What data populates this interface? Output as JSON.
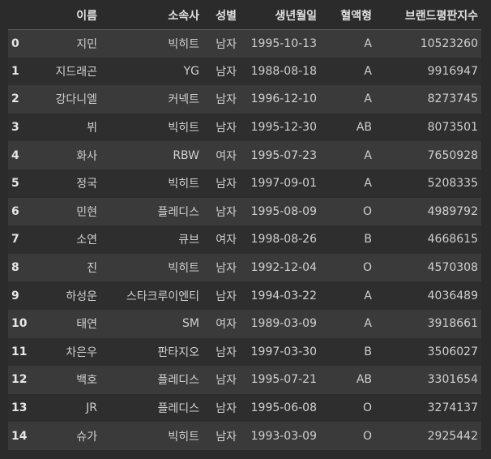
{
  "table": {
    "columns": [
      "",
      "이름",
      "소속사",
      "성별",
      "생년월일",
      "혈액형",
      "브랜드평판지수"
    ],
    "rows": [
      {
        "index": "0",
        "name": "지민",
        "agency": "빅히트",
        "gender": "남자",
        "birth": "1995-10-13",
        "blood": "A",
        "brand": "10523260"
      },
      {
        "index": "1",
        "name": "지드래곤",
        "agency": "YG",
        "gender": "남자",
        "birth": "1988-08-18",
        "blood": "A",
        "brand": "9916947"
      },
      {
        "index": "2",
        "name": "강다니엘",
        "agency": "커넥트",
        "gender": "남자",
        "birth": "1996-12-10",
        "blood": "A",
        "brand": "8273745"
      },
      {
        "index": "3",
        "name": "뷔",
        "agency": "빅히트",
        "gender": "남자",
        "birth": "1995-12-30",
        "blood": "AB",
        "brand": "8073501"
      },
      {
        "index": "4",
        "name": "화사",
        "agency": "RBW",
        "gender": "여자",
        "birth": "1995-07-23",
        "blood": "A",
        "brand": "7650928"
      },
      {
        "index": "5",
        "name": "정국",
        "agency": "빅히트",
        "gender": "남자",
        "birth": "1997-09-01",
        "blood": "A",
        "brand": "5208335"
      },
      {
        "index": "6",
        "name": "민현",
        "agency": "플레디스",
        "gender": "남자",
        "birth": "1995-08-09",
        "blood": "O",
        "brand": "4989792"
      },
      {
        "index": "7",
        "name": "소연",
        "agency": "큐브",
        "gender": "여자",
        "birth": "1998-08-26",
        "blood": "B",
        "brand": "4668615"
      },
      {
        "index": "8",
        "name": "진",
        "agency": "빅히트",
        "gender": "남자",
        "birth": "1992-12-04",
        "blood": "O",
        "brand": "4570308"
      },
      {
        "index": "9",
        "name": "하성운",
        "agency": "스타크루이엔티",
        "gender": "남자",
        "birth": "1994-03-22",
        "blood": "A",
        "brand": "4036489"
      },
      {
        "index": "10",
        "name": "태연",
        "agency": "SM",
        "gender": "여자",
        "birth": "1989-03-09",
        "blood": "A",
        "brand": "3918661"
      },
      {
        "index": "11",
        "name": "차은우",
        "agency": "판타지오",
        "gender": "남자",
        "birth": "1997-03-30",
        "blood": "B",
        "brand": "3506027"
      },
      {
        "index": "12",
        "name": "백호",
        "agency": "플레디스",
        "gender": "남자",
        "birth": "1995-07-21",
        "blood": "AB",
        "brand": "3301654"
      },
      {
        "index": "13",
        "name": "JR",
        "agency": "플레디스",
        "gender": "남자",
        "birth": "1995-06-08",
        "blood": "O",
        "brand": "3274137"
      },
      {
        "index": "14",
        "name": "슈가",
        "agency": "빅히트",
        "gender": "남자",
        "birth": "1993-03-09",
        "blood": "O",
        "brand": "2925442"
      }
    ]
  }
}
